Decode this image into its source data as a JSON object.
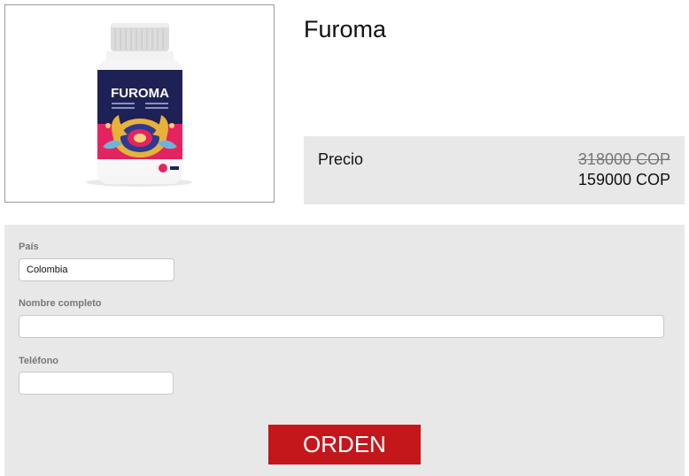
{
  "product": {
    "title": "Furoma",
    "image": {
      "brand_text": "FUROMA",
      "colors": {
        "cap": "#e6e6e6",
        "label_navy": "#1e2156",
        "label_pink": "#e5235f",
        "accent_gold": "#e7b23a"
      }
    }
  },
  "price": {
    "label": "Precio",
    "old": "318000 COP",
    "new": "159000 COP"
  },
  "form": {
    "country_label": "País",
    "country_value": "Colombia",
    "name_label": "Nombre completo",
    "name_value": "",
    "phone_label": "Teléfono",
    "phone_value": "",
    "submit_label": "ORDEN"
  },
  "colors": {
    "panel_bg": "#e8e8e8",
    "button_red": "#c4171c"
  }
}
